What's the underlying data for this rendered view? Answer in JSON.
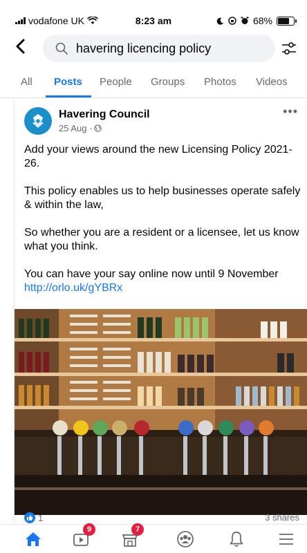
{
  "status_bar": {
    "carrier": "vodafone UK",
    "time": "8:23 am",
    "battery": "68%",
    "battery_level": 0.68
  },
  "header": {
    "search_value": "havering licencing policy"
  },
  "tabs": [
    {
      "label": "All",
      "active": false
    },
    {
      "label": "Posts",
      "active": true
    },
    {
      "label": "People",
      "active": false
    },
    {
      "label": "Groups",
      "active": false
    },
    {
      "label": "Photos",
      "active": false
    },
    {
      "label": "Videos",
      "active": false
    }
  ],
  "post": {
    "author": "Havering Council",
    "date": "25 Aug · ",
    "paragraphs": [
      "Add your views around the new Licensing Policy 2021-26.",
      "This policy enables us to help businesses operate safely & within the law,",
      "So whether you are a resident or a licensee, let us know what you think.",
      "You can have your say online now until 9 November"
    ],
    "link": "http://orlo.uk/gYBRx",
    "reaction_count": "1",
    "shares": "3 shares"
  },
  "bottom_nav": {
    "video_badge": "9",
    "marketplace_badge": "7"
  },
  "colors": {
    "accent": "#1877f2",
    "badge": "#e41e3f"
  }
}
